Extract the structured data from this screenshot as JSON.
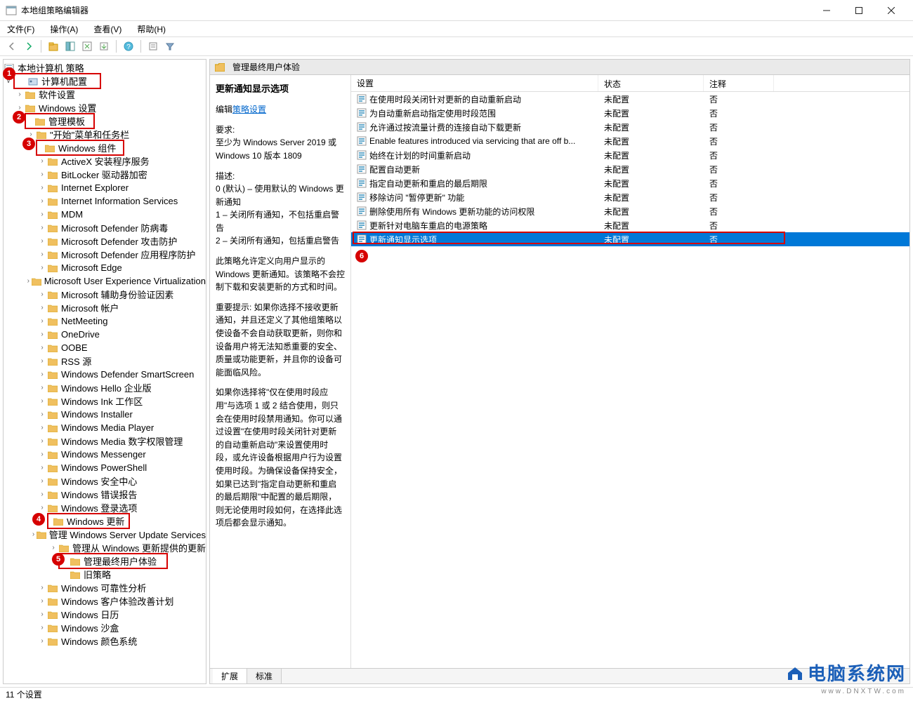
{
  "window": {
    "title": "本地组策略编辑器"
  },
  "menu": {
    "file": "文件(F)",
    "action": "操作(A)",
    "view": "查看(V)",
    "help": "帮助(H)"
  },
  "tree": {
    "root": "本地计算机 策略",
    "computer_config": "计算机配置",
    "software_settings": "软件设置",
    "windows_settings": "Windows 设置",
    "admin_templates": "管理模板",
    "start_taskbar": "\"开始\"菜单和任务栏",
    "windows_components": "Windows 组件",
    "items": [
      "ActiveX 安装程序服务",
      "BitLocker 驱动器加密",
      "Internet Explorer",
      "Internet Information Services",
      "MDM",
      "Microsoft Defender 防病毒",
      "Microsoft Defender 攻击防护",
      "Microsoft Defender 应用程序防护",
      "Microsoft Edge",
      "Microsoft User Experience Virtualization",
      "Microsoft 辅助身份验证因素",
      "Microsoft 帐户",
      "NetMeeting",
      "OneDrive",
      "OOBE",
      "RSS 源",
      "Windows Defender SmartScreen",
      "Windows Hello 企业版",
      "Windows Ink 工作区",
      "Windows Installer",
      "Windows Media Player",
      "Windows Media 数字权限管理",
      "Windows Messenger",
      "Windows PowerShell",
      "Windows 安全中心",
      "Windows 错误报告",
      "Windows 登录选项"
    ],
    "windows_update": "Windows 更新",
    "wu_sub1": "管理 Windows Server Update Services",
    "wu_sub2": "管理从 Windows 更新提供的更新",
    "wu_sub3": "管理最终用户体验",
    "old_policy": "旧策略",
    "tail": [
      "Windows 可靠性分析",
      "Windows 客户体验改善计划",
      "Windows 日历",
      "Windows 沙盒",
      "Windows 颜色系统"
    ]
  },
  "right": {
    "header": "管理最终用户体验",
    "desc_title": "更新通知显示选项",
    "edit_label": "编辑",
    "policy_link": "策略设置",
    "req_label": "要求:",
    "req_text": "至少为 Windows Server 2019 或 Windows 10 版本 1809",
    "desc_label": "描述:",
    "desc_p1": "0 (默认) – 使用默认的 Windows 更新通知",
    "desc_p2": "1 – 关闭所有通知，不包括重启警告",
    "desc_p3": "2 – 关闭所有通知，包括重启警告",
    "desc_p4": "此策略允许定义向用户显示的 Windows 更新通知。该策略不会控制下载和安装更新的方式和时间。",
    "desc_p5": "重要提示: 如果你选择不接收更新通知，并且还定义了其他组策略以使设备不会自动获取更新，则你和设备用户将无法知悉重要的安全、质量或功能更新，并且你的设备可能面临风险。",
    "desc_p6": "如果你选择将\"仅在使用时段应用\"与选项 1 或 2 结合使用，则只会在使用时段禁用通知。你可以通过设置\"在使用时段关闭针对更新的自动重新启动\"来设置使用时段，或允许设备根据用户行为设置使用时段。为确保设备保持安全，如果已达到\"指定自动更新和重启的最后期限\"中配置的最后期限，则无论使用时段如何，在选择此选项后都会显示通知。"
  },
  "columns": {
    "setting": "设置",
    "state": "状态",
    "note": "注释"
  },
  "policies": [
    {
      "name": "在使用时段关闭针对更新的自动重新启动",
      "state": "未配置",
      "note": "否"
    },
    {
      "name": "为自动重新启动指定使用时段范围",
      "state": "未配置",
      "note": "否"
    },
    {
      "name": "允许通过按流量计费的连接自动下载更新",
      "state": "未配置",
      "note": "否"
    },
    {
      "name": "Enable features introduced via servicing that are off b...",
      "state": "未配置",
      "note": "否"
    },
    {
      "name": "始终在计划的时间重新启动",
      "state": "未配置",
      "note": "否"
    },
    {
      "name": "配置自动更新",
      "state": "未配置",
      "note": "否"
    },
    {
      "name": "指定自动更新和重启的最后期限",
      "state": "未配置",
      "note": "否"
    },
    {
      "name": "移除访问 \"暂停更新\" 功能",
      "state": "未配置",
      "note": "否"
    },
    {
      "name": "删除使用所有 Windows 更新功能的访问权限",
      "state": "未配置",
      "note": "否"
    },
    {
      "name": "更新针对电脑车重启的电源策略",
      "state": "未配置",
      "note": "否"
    },
    {
      "name": "更新通知显示选项",
      "state": "未配置",
      "note": "否",
      "selected": true
    }
  ],
  "tabs": {
    "extended": "扩展",
    "standard": "标准"
  },
  "status": "11 个设置",
  "watermark": {
    "main": "电脑系统网",
    "sub": "www.DNXTW.com"
  },
  "badges": [
    "1",
    "2",
    "3",
    "4",
    "5",
    "6"
  ]
}
